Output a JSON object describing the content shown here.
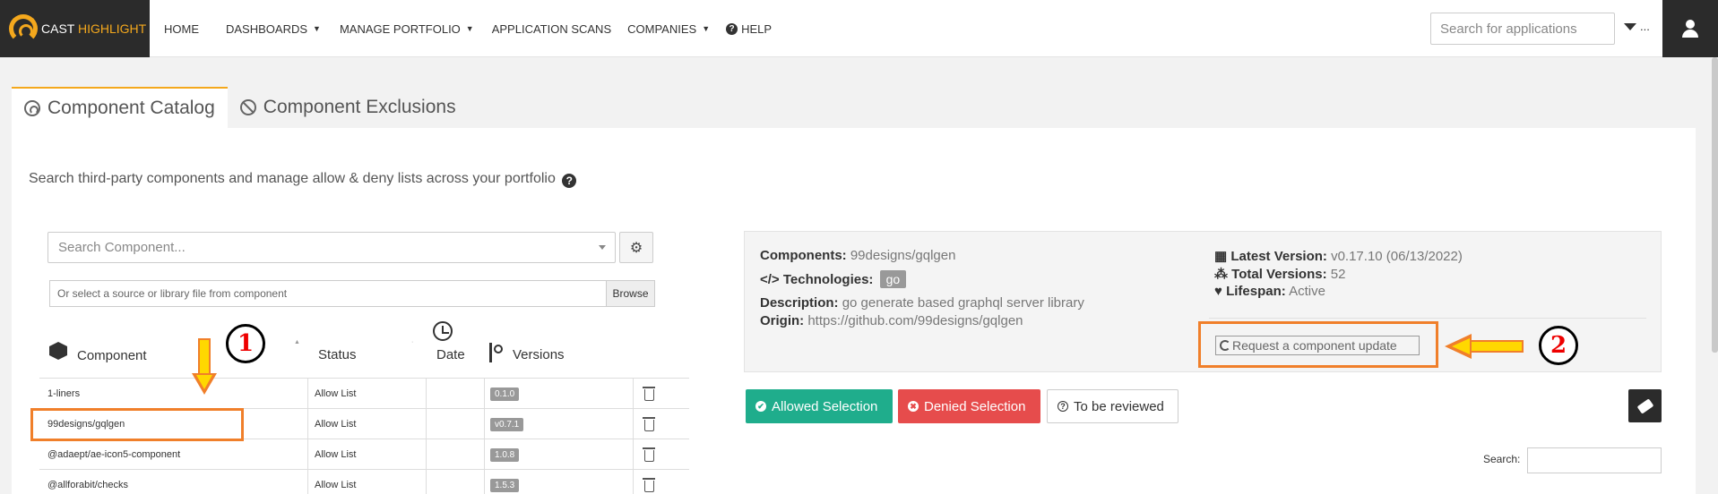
{
  "brand": {
    "part1": "CAST ",
    "part2": "HIGHLIGHT",
    "accent": "#f4a81d"
  },
  "nav": {
    "home": "HOME",
    "dashboards": "DASHBOARDS",
    "manage_portfolio": "MANAGE PORTFOLIO",
    "application_scans": "APPLICATION SCANS",
    "companies": "COMPANIES",
    "help": "HELP",
    "help_icon_glyph": "?"
  },
  "header": {
    "search_placeholder": "Search for applications",
    "filter_label": "..."
  },
  "tabs": [
    {
      "label": "Component Catalog"
    },
    {
      "label": "Component Exclusions"
    }
  ],
  "main": {
    "subtitle": "Search third-party components and manage allow & deny lists across your portfolio",
    "help_glyph": "?",
    "component_search_placeholder": "Search Component...",
    "gear_glyph": "⚙",
    "file_placeholder": "Or select a source or library file from component",
    "browse_label": "Browse"
  },
  "table": {
    "columns": {
      "component": "Component",
      "status": "Status",
      "date": "Date",
      "versions": "Versions"
    },
    "rows": [
      {
        "component": "1-liners",
        "status": "Allow List",
        "date": "",
        "version": "0.1.0"
      },
      {
        "component": "99designs/gqlgen",
        "status": "Allow List",
        "date": "",
        "version": "v0.7.1"
      },
      {
        "component": "@adaept/ae-icon5-component",
        "status": "Allow List",
        "date": "",
        "version": "1.0.8"
      },
      {
        "component": "@allforabit/checks",
        "status": "Allow List",
        "date": "",
        "version": "1.5.3"
      }
    ]
  },
  "annotations": {
    "one": "1",
    "two": "2"
  },
  "info": {
    "components_label": "Components:",
    "components_value": "99designs/gqlgen",
    "technologies_label": "Technologies:",
    "technologies_code_glyph": "</>",
    "technologies_value": "go",
    "description_label": "Description:",
    "description_value": "go generate based graphql server library",
    "origin_label": "Origin:",
    "origin_value": "https://github.com/99designs/gqlgen",
    "latest_version_label": "Latest Version:",
    "latest_version_value": "v0.17.10 (06/13/2022)",
    "total_versions_label": "Total Versions:",
    "total_versions_value": "52",
    "lifespan_label": "Lifespan:",
    "lifespan_value": "Active",
    "request_update_label": "Request a component update"
  },
  "selection": {
    "allowed": "Allowed Selection",
    "denied": "Denied Selection",
    "review": "To be reviewed",
    "allowed_glyph": "✔",
    "denied_glyph": "✖",
    "review_glyph": "?"
  },
  "table_search": {
    "label": "Search:"
  },
  "colors": {
    "allowed": "#1fad8c",
    "denied": "#e64c4c",
    "annotation": "#f07f2a",
    "dark": "#2b2b2b"
  }
}
